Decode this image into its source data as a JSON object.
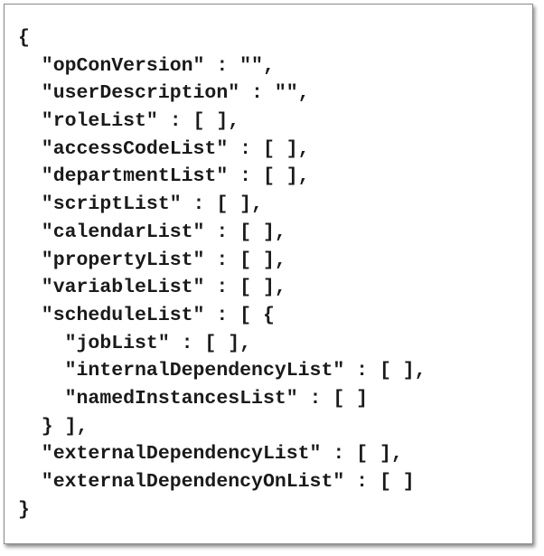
{
  "code_lines": [
    "{",
    "  \"opConVersion\" : \"\",",
    "  \"userDescription\" : \"\",",
    "  \"roleList\" : [ ],",
    "  \"accessCodeList\" : [ ],",
    "  \"departmentList\" : [ ],",
    "  \"scriptList\" : [ ],",
    "  \"calendarList\" : [ ],",
    "  \"propertyList\" : [ ],",
    "  \"variableList\" : [ ],",
    "  \"scheduleList\" : [ {",
    "    \"jobList\" : [ ],",
    "    \"internalDependencyList\" : [ ],",
    "    \"namedInstancesList\" : [ ]",
    "  } ],",
    "  \"externalDependencyList\" : [ ],",
    "  \"externalDependencyOnList\" : [ ]",
    "}"
  ],
  "colors": {
    "text": "#1a1a1a",
    "border": "#8a8a8a",
    "background": "#ffffff"
  }
}
